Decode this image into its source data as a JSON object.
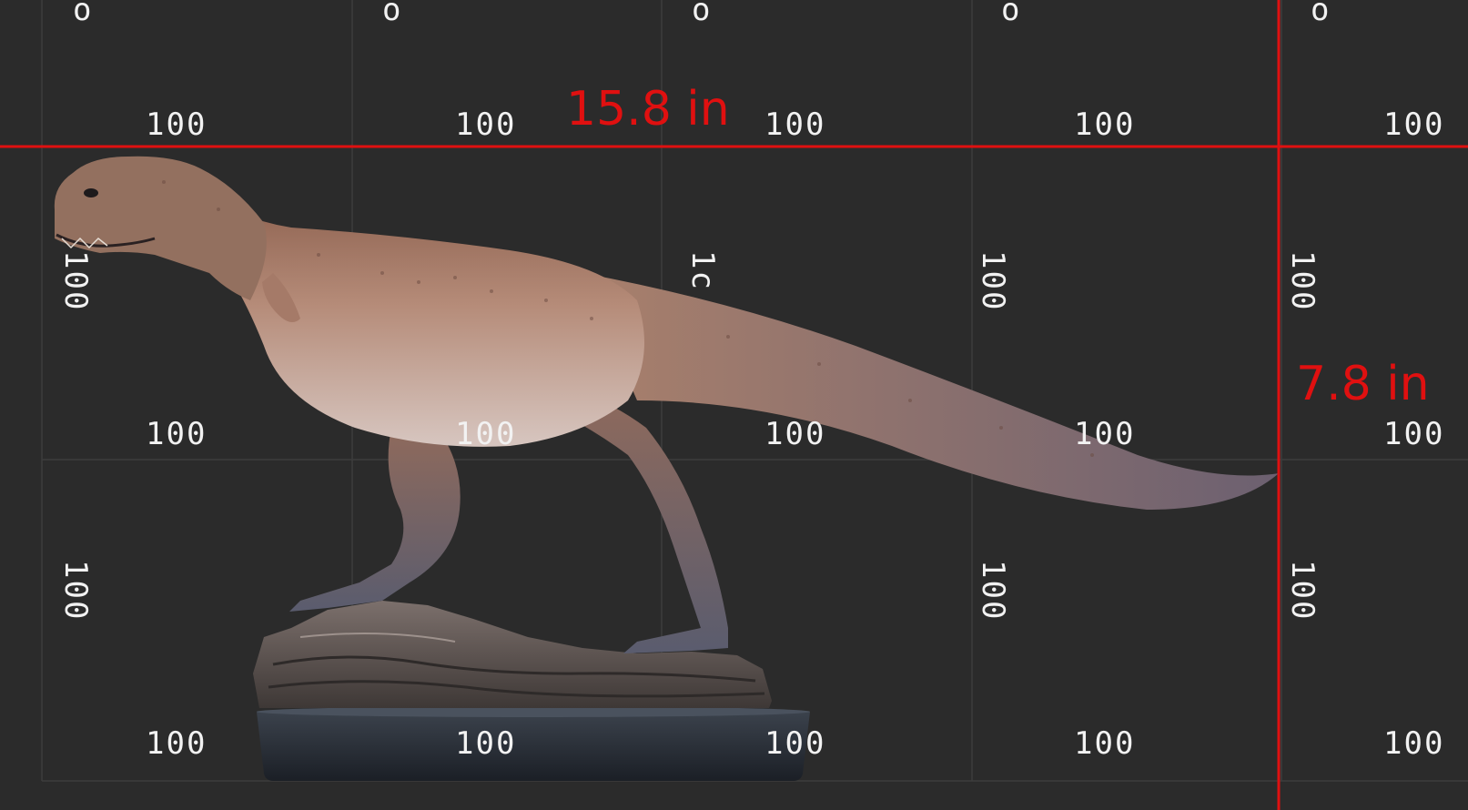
{
  "scene": {
    "subject": "dinosaur-sculpture",
    "background_color": "#2b2b2b",
    "grid_line_color": "#3d3d3d",
    "measure_color": "#e01010"
  },
  "measurements": {
    "width_label": "15.8 in",
    "height_label": "7.8 in"
  },
  "grid": {
    "cell_label": "100",
    "partial_label": "1c"
  }
}
